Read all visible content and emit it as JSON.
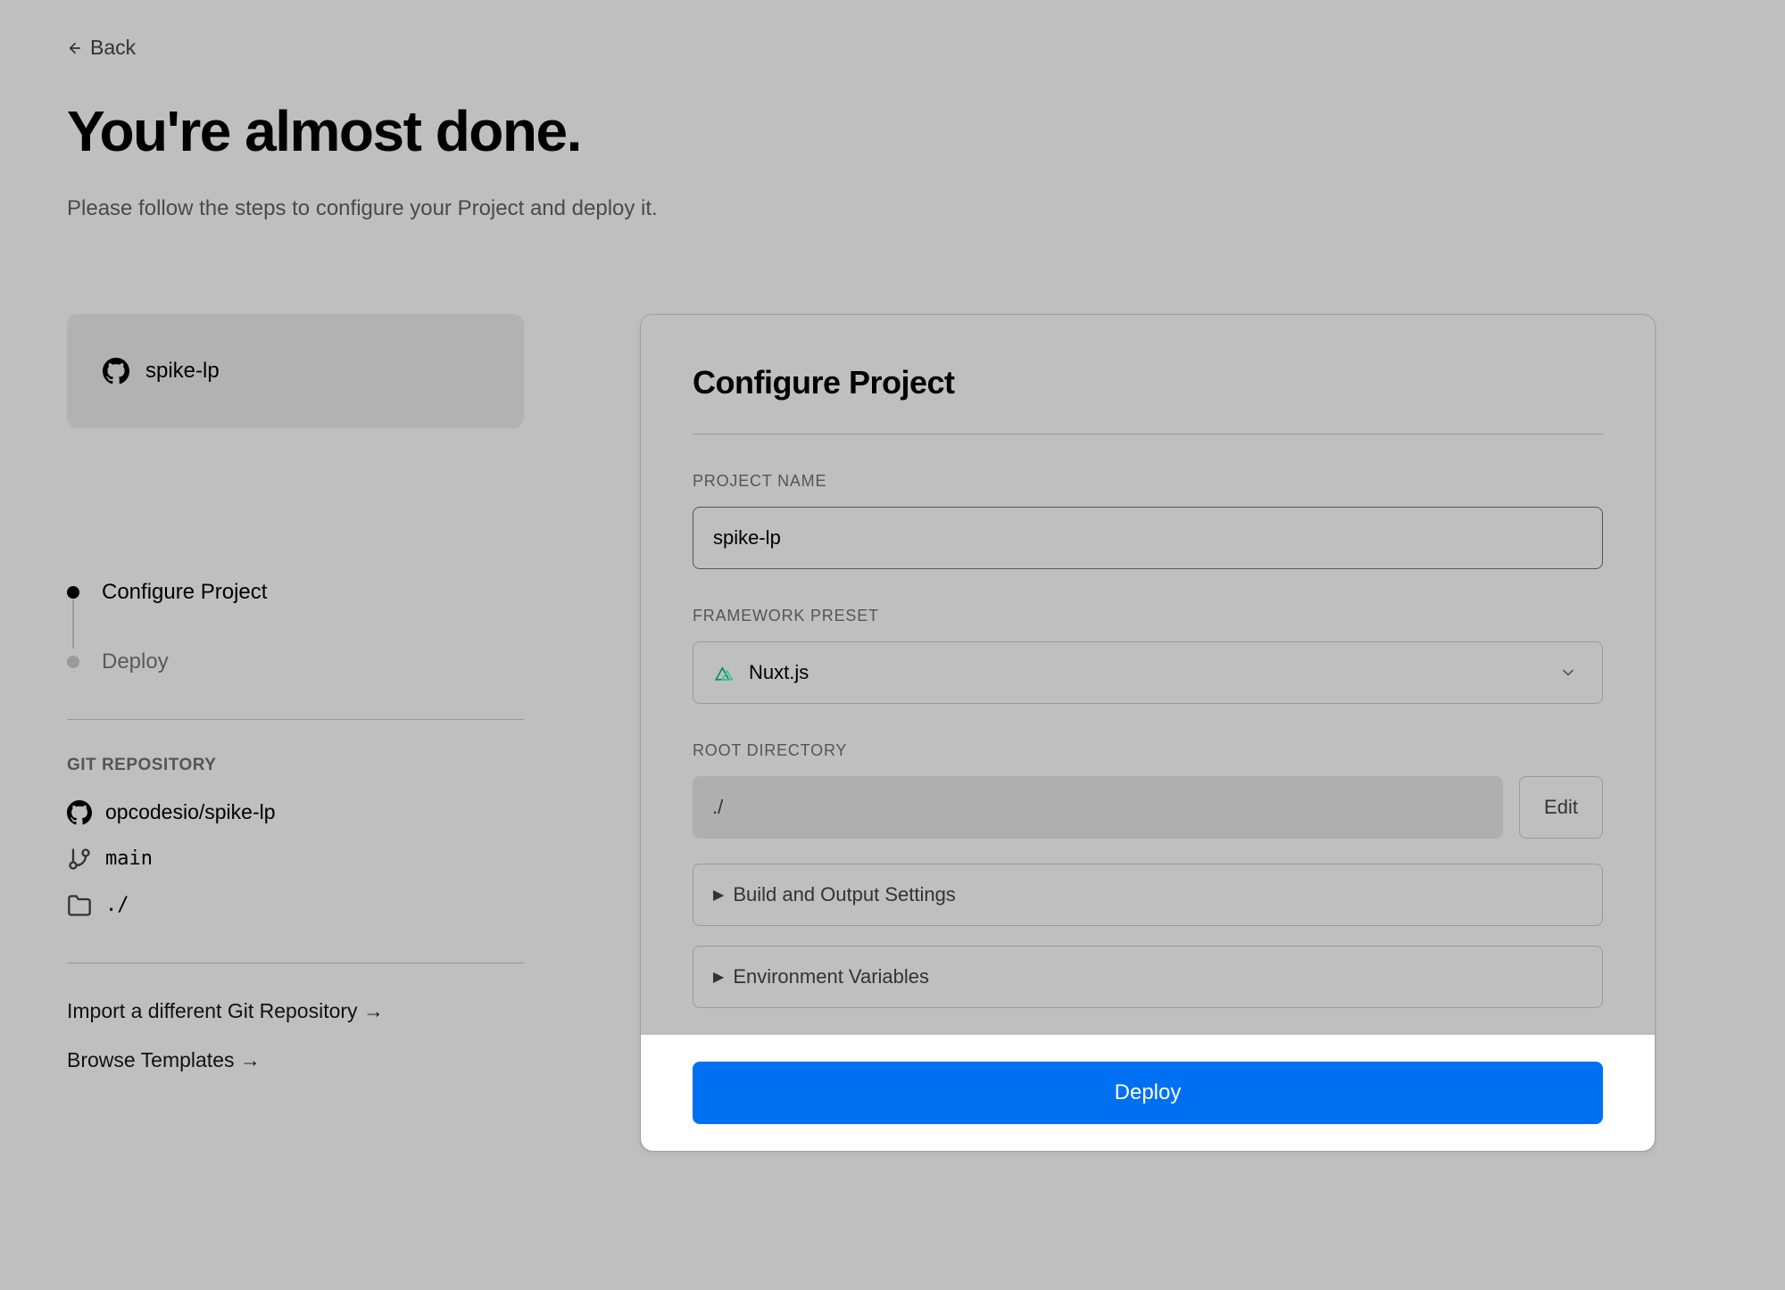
{
  "header": {
    "back_label": "Back",
    "title": "You're almost done.",
    "subtitle": "Please follow the steps to configure your Project and deploy it."
  },
  "sidebar": {
    "repo_name": "spike-lp",
    "steps": [
      {
        "label": "Configure Project",
        "active": true
      },
      {
        "label": "Deploy",
        "active": false
      }
    ],
    "git_section_label": "GIT REPOSITORY",
    "git_repo": "opcodesio/spike-lp",
    "git_branch": "main",
    "git_path": "./",
    "import_link": "Import a different Git Repository →",
    "browse_link": "Browse Templates →"
  },
  "config": {
    "title": "Configure Project",
    "project_name_label": "PROJECT NAME",
    "project_name_value": "spike-lp",
    "framework_label": "FRAMEWORK PRESET",
    "framework_value": "Nuxt.js",
    "root_label": "ROOT DIRECTORY",
    "root_value": "./",
    "edit_label": "Edit",
    "accordion_build": "Build and Output Settings",
    "accordion_env": "Environment Variables",
    "deploy_label": "Deploy"
  },
  "colors": {
    "primary": "#0070f3"
  }
}
